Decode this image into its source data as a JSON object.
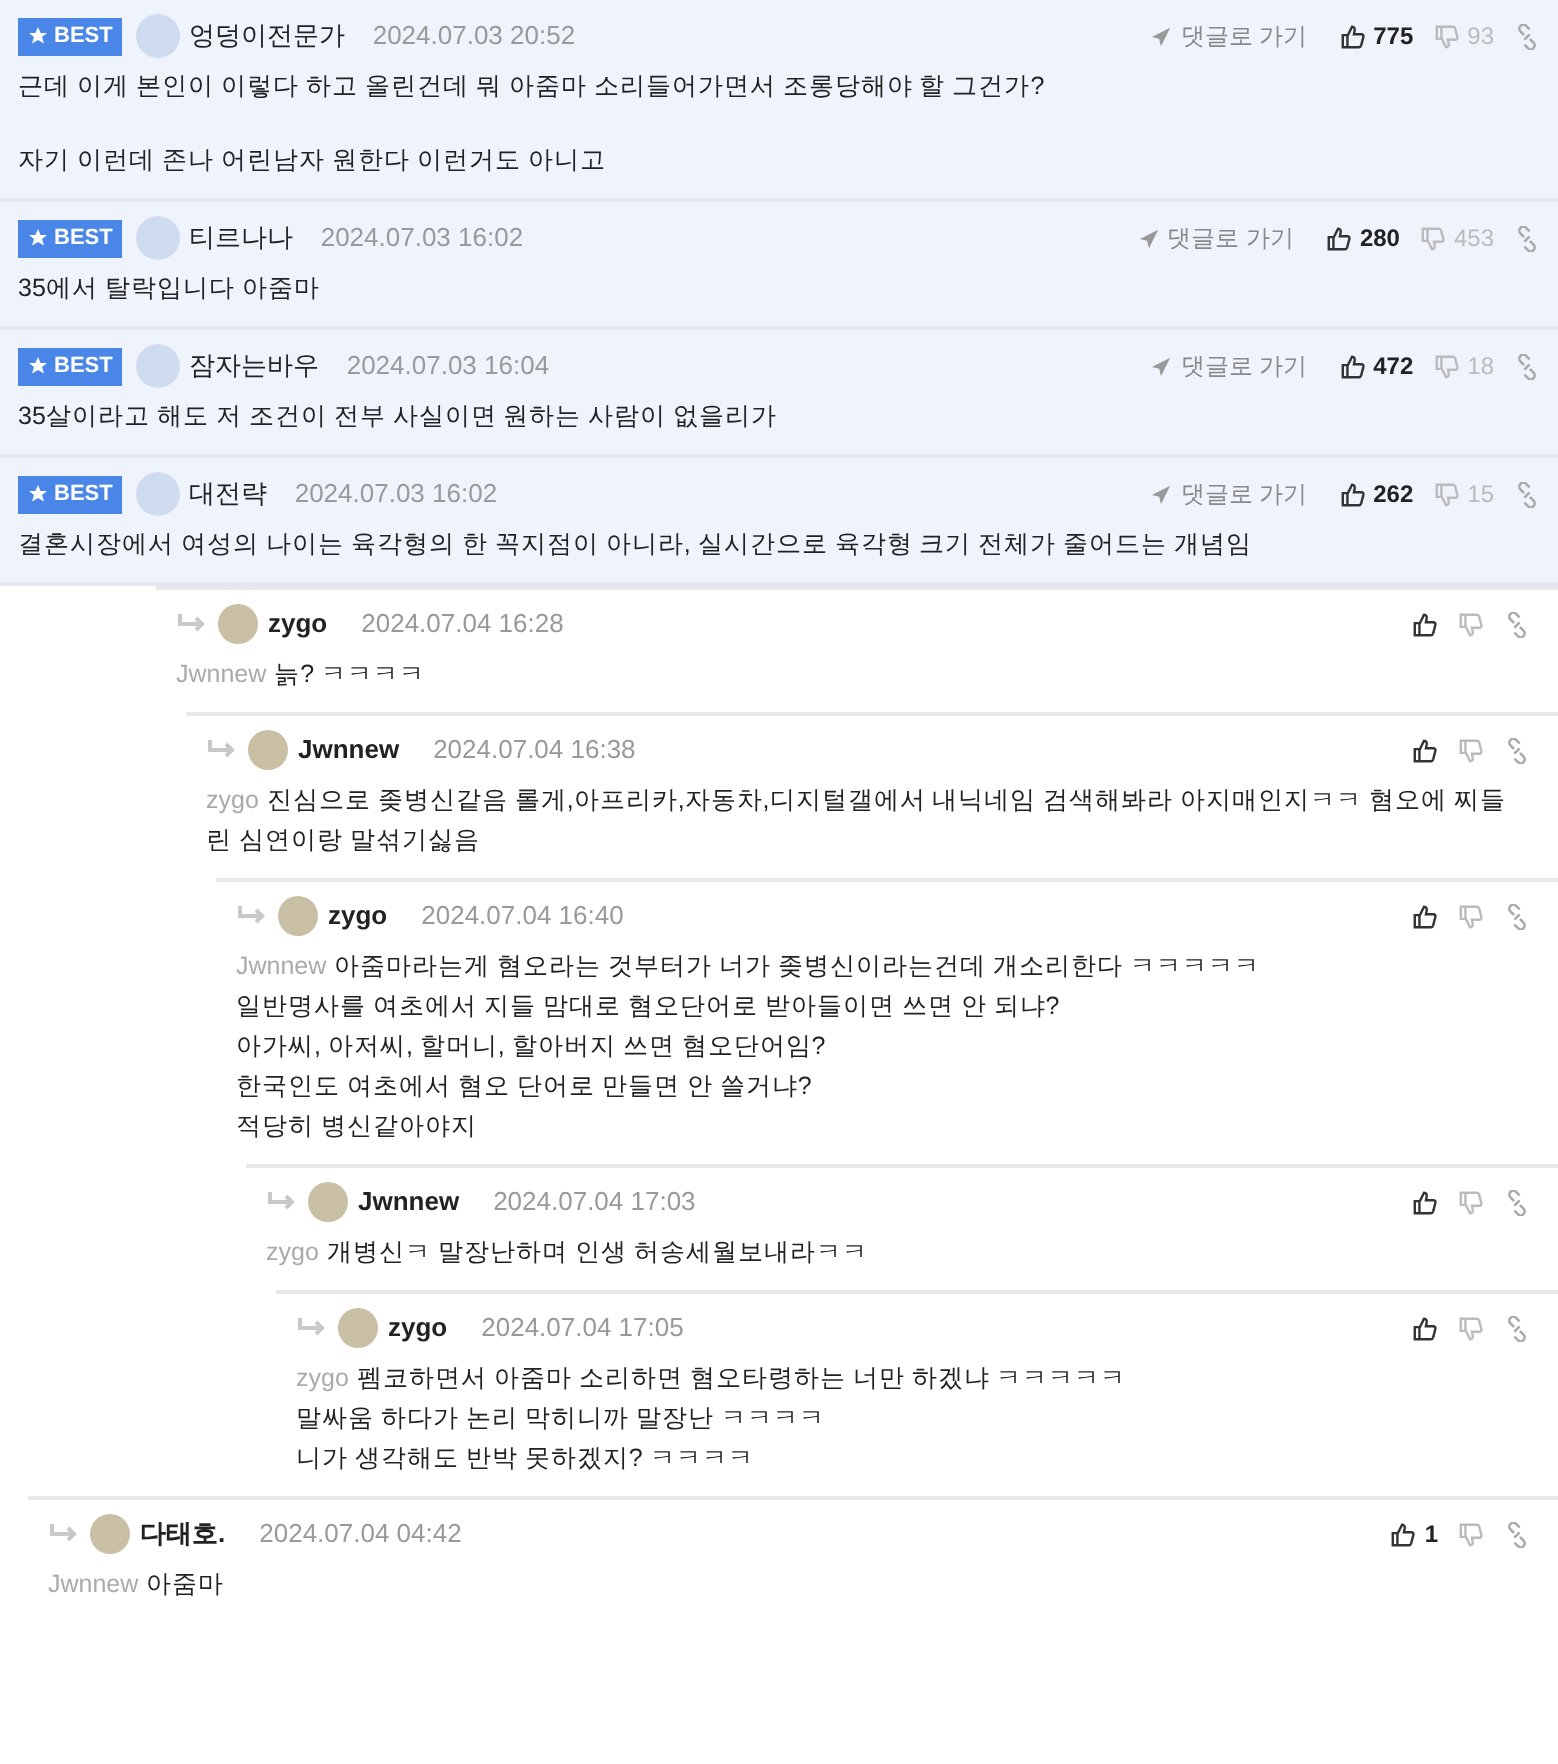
{
  "best_comments": [
    {
      "badge": "BEST",
      "author": "엉덩이전문가",
      "date": "2024.07.03 20:52",
      "goto": "댓글로 가기",
      "likes": "775",
      "dislikes": "93",
      "paragraphs": [
        "근데 이게 본인이 이렇다 하고 올린건데 뭐 아줌마 소리들어가면서 조롱당해야 할 그건가?",
        "자기 이런데 존나 어린남자 원한다 이런거도 아니고"
      ]
    },
    {
      "badge": "BEST",
      "author": "티르나나",
      "date": "2024.07.03 16:02",
      "goto": "댓글로 가기",
      "likes": "280",
      "dislikes": "453",
      "paragraphs": [
        "35에서 탈락입니다 아줌마"
      ]
    },
    {
      "badge": "BEST",
      "author": "잠자는바우",
      "date": "2024.07.03 16:04",
      "goto": "댓글로 가기",
      "likes": "472",
      "dislikes": "18",
      "paragraphs": [
        "35살이라고 해도 저 조건이 전부 사실이면 원하는 사람이 없을리가"
      ]
    },
    {
      "badge": "BEST",
      "author": "대전략",
      "date": "2024.07.03 16:02",
      "goto": "댓글로 가기",
      "likes": "262",
      "dislikes": "15",
      "paragraphs": [
        "결혼시장에서 여성의 나이는 육각형의 한 꼭지점이 아니라, 실시간으로 육각형 크기 전체가 줄어드는 개념임"
      ]
    }
  ],
  "replies": [
    {
      "author": "zygo",
      "date": "2024.07.04 16:28",
      "mention": "Jwnnew",
      "lines": [
        "늙? ㅋㅋㅋㅋ"
      ],
      "children": [
        {
          "author": "Jwnnew",
          "date": "2024.07.04 16:38",
          "mention": "zygo",
          "lines": [
            "진심으로 좆병신같음 롤게,아프리카,자동차,디지털갤에서 내닉네임 검색해봐라 아지매인지ㅋㅋ 혐오에 찌들린 심연이랑 말섞기싫음"
          ],
          "children": [
            {
              "author": "zygo",
              "date": "2024.07.04 16:40",
              "mention": "Jwnnew",
              "lines": [
                "아줌마라는게 혐오라는 것부터가 너가 좆병신이라는건데 개소리한다 ㅋㅋㅋㅋㅋ",
                "일반명사를 여초에서 지들 맘대로 혐오단어로 받아들이면 쓰면 안 되냐?",
                "아가씨, 아저씨, 할머니, 할아버지 쓰면 혐오단어임?",
                "한국인도 여초에서 혐오 단어로 만들면 안 쓸거냐?",
                "적당히 병신같아야지"
              ],
              "children": [
                {
                  "author": "Jwnnew",
                  "date": "2024.07.04 17:03",
                  "mention": "zygo",
                  "lines": [
                    "개병신ㅋ 말장난하며 인생 허송세월보내라ㅋㅋ"
                  ],
                  "children": [
                    {
                      "author": "zygo",
                      "date": "2024.07.04 17:05",
                      "mention": "zygo",
                      "lines": [
                        "펨코하면서 아줌마 소리하면 혐오타령하는 너만 하겠냐 ㅋㅋㅋㅋㅋ",
                        "말싸움 하다가 논리 막히니까 말장난 ㅋㅋㅋㅋ",
                        "니가 생각해도 반박 못하겠지? ㅋㅋㅋㅋ"
                      ]
                    }
                  ]
                }
              ]
            }
          ]
        }
      ]
    },
    {
      "author": "다태호.",
      "date": "2024.07.04 04:42",
      "mention": "Jwnnew",
      "likes": "1",
      "lines": [
        "아줌마"
      ]
    }
  ]
}
